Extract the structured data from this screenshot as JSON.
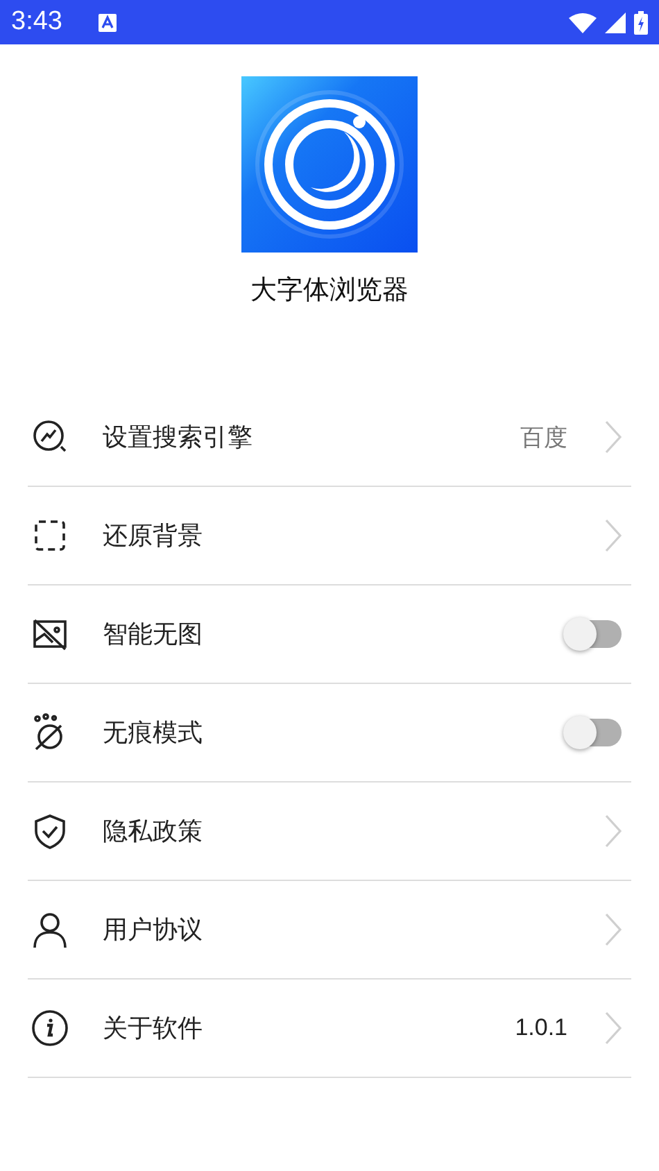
{
  "status_bar": {
    "time": "3:43"
  },
  "app": {
    "name": "大字体浏览器"
  },
  "settings": [
    {
      "kind": "link",
      "label": "设置搜索引擎",
      "value": "百度"
    },
    {
      "kind": "link",
      "label": "还原背景"
    },
    {
      "kind": "toggle",
      "label": "智能无图",
      "on": false
    },
    {
      "kind": "toggle",
      "label": "无痕模式",
      "on": false
    },
    {
      "kind": "link",
      "label": "隐私政策"
    },
    {
      "kind": "link",
      "label": "用户协议"
    },
    {
      "kind": "link",
      "label": "关于软件",
      "value": "1.0.1"
    }
  ]
}
